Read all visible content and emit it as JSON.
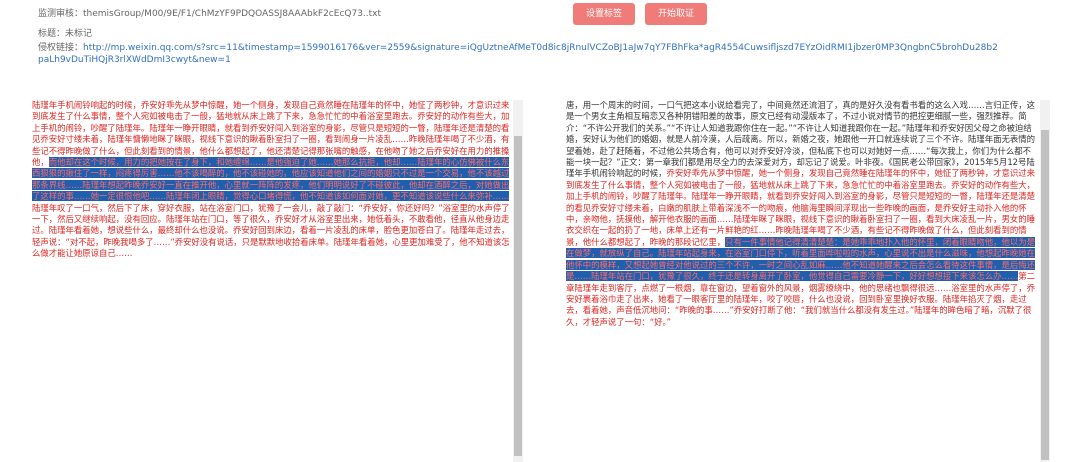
{
  "header": {
    "audit_label": "监测审核：",
    "audit_value": "themisGroup/M00/9E/F1/ChMzYF9PDQOASSJ8AAAbkF2cEcQ73..txt",
    "title_label": "标题：",
    "title_value": "未标记",
    "link_label": "侵权链接：",
    "link_url": "http://mp.weixin.qq.com/s?src=11&timestamp=1599016176&ver=2559&signature=iQgUztneAfMeT0d8ic8jRnulVCZoBJ1aJw7qY7FBhFka*agR4554Cuwsifljszd7EYzOidRMI1jbzer0MP3QngbnC5brohDu28b2paLh9vDuTiHQjR3rlXWdDmI3cwyt&new=1"
  },
  "buttons": {
    "set_tag": "设置标签",
    "start": "开始取证"
  },
  "left_panel": {
    "s1": "陆瑾年手机闹铃响起的时候，乔安好乖先从梦中惊醒，她一个侧身，发现自己竟然睡在陆瑾年的怀中，她怔了两秒钟，才意识过来到底发生了什么事情，整个人宛如被电击了一般，猛地就从床上跳了下来，急急忙忙的中着浴室里跑去。乔安好的动作有些大，加上手机的闹铃，吵醒了陆瑾年。陆瑾年一睁开眼睛，就看到乔安好闯入到浴室的身影，尽管只是短短的一瞥，陆瑾年还是清楚的看见乔安好寸缕未着，陆瑾年慵懒地眯了眯眼，视线下意识的瞅着卧室扫了一圈，看到闹身一片凌乱……昨晚陆瑾年喝了不少酒，有些记不得昨晚做了什么，但此刻看到的情景，他什么都想起了，他还清楚记得那张嘴的触感，在他吻了她之后乔安好在用力的推搡他，",
    "h1": "而他却在这个时候，用力的把她按在了身下，和她缠绵……是他强迫了她……她那么抗拒，他却……陆瑾年的心仿佛被什么东西狠狠的揪住了一样，闷疼得厉害……他不该喝醉的，他不该碰她的，他应该知道他们之间的婚姻只不过是一个交易，他不该越过那条界线……陆瑾年想起昨晚乔安好一直在推开他，心里就一阵阵的发疼，他们明明说好了不碰彼此，他却在酒醉之后，对她做出了这样的事……她一定很恨他吧……陆瑾年闭上眼睛，觉得心口堵得慌，他不知道该如何面对她，更不知道该说些什么来弥补……",
    "s2": "陆瑾年叹了一口气，然后下了床，穿好衣服，站在浴室门口，犹豫了一会儿，敲了敲门：“乔安好，你还好吗？”浴室里的水声停了一下，然后又继续响起，没有回应。陆瑾年站在门口，等了很久，乔安好才从浴室里出来，她低着头，不敢看他，径直从他身边走过。陆瑾年看着她，想说些什么，最终却什么也没说。乔安好回到床边，看着一片凌乱的床单，脸色更加苍白了。陆瑾年走过去，轻声说：“对不起，昨晚我喝多了……”乔安好没有说话，只是默默地收拾着床单。陆瑾年看着她，心里更加难受了，他不知道该怎么做才能让她原谅自己……"
  },
  "right_panel": {
    "s1": "唐，用一个周末的时间，一口气把这本小说给看完了，中间竟然还流泪了，真的是好久没有看书看的这么入戏……言归正传，这是一个男女主角相互暗恋又各种阴错阳差的故事，原文已经有动漫版本了，不过小说对情节的把控更细腻一些，强烈推荐。简介：“不许公开我们的关系。”“不许让人知道我跟你住在一起。”“不许让人知道我跟你在一起。”陆瑾年和乔安好因父母之命被迫结婚，安好认为他们的婚姻，就是人前冷漠，人后疏离。所以，新婚之夜，她跟他一开口就连续说了三个不许。陆瑾年面无表情的望着她，赴了赶随着，不过他公共场合有，他可以对乔安好冷淡，但私底下也可以对她好一点……“每次我上，你们为什么都不能一块一起？”正文：第一章我们都是用尽全力的去深爱对方，却忘记了说爱。叶非夜。《国民老公带回家》，2015年5月12号陆瑾年手机闹铃响起的时候，",
    "s2": "乔安好乖先从梦中惊醒，她一个侧身，发现自己竟然睡在陆瑾年的怀中，她怔了两秒钟，才意识过来到底发生了什么事情，整个人宛如被电击了一般，猛地就从床上跳了下来，急急忙忙的中着浴室里跑去。乔安好的动作有些大，加上手机的闹铃，吵醒了陆瑾年。陆瑾年一睁开眼睛，就看到乔安好闯入到浴室的身影，尽管只是短短的一瞥，陆瑾年还是清楚的看见乔安好寸缕未着，白嫩的肌肤上带着深浅不一的吻痕，他脑海里瞬间浮现出一些昨晚的画面，是乔安好主动扑入他的怀中，亲吻他，抚摸他，解开他衣服的画面……陆瑾年眯了眯眼，视线下意识的瞅着卧室扫了一圈，看到大床凌乱一片，男女的睡衣交织在一起的扔了一地，床单上还有一片鲜艳的红……昨晚陆瑾年喝了不少酒，有些记不得昨晚做了什么，但此刻看到的情景，他什么都想起了，昨晚的那段记忆里，",
    "h1": "只有一件事情他记得清清楚楚：是她乖乖地扑入他的怀里，闭着眼睛吻他，他以为是在做梦，就放纵了自己。陆瑾年站起身来，在浴室门口停下，听着里面哗啦啦的水声，心里说不出是什么滋味，他想起昨晚她在他怀中的模样，又想起她曾经对他说过的三个不许，一时之间心乱如麻……他不知道她醒来之后会怎么看待这件事情，是后悔还是……陆瑾年站在门口，犹豫了很久，终于还是转身离开了卧室，他觉得自己需要冷静一下，好好想想接下来该怎么办……",
    "s3": "第二章陆瑾年走到客厅，点燃了一根烟，靠在窗边，望着窗外的风景，烟雾缭绕中，他的思绪也飘得很远……浴室里的水声停了，乔安好裹着浴巾走了出来，她看了一眼客厅里的陆瑾年，咬了咬唇，什么也没说，回到卧室里换好衣服。陆瑾年掐灭了烟，走过去，看着她，声音低沉地问：“昨晚的事……”乔安好打断了他：“我们就当什么都没有发生过。”陆瑾年的眸色暗了暗，沉默了很久，才轻声说了一句：“好。”"
  }
}
